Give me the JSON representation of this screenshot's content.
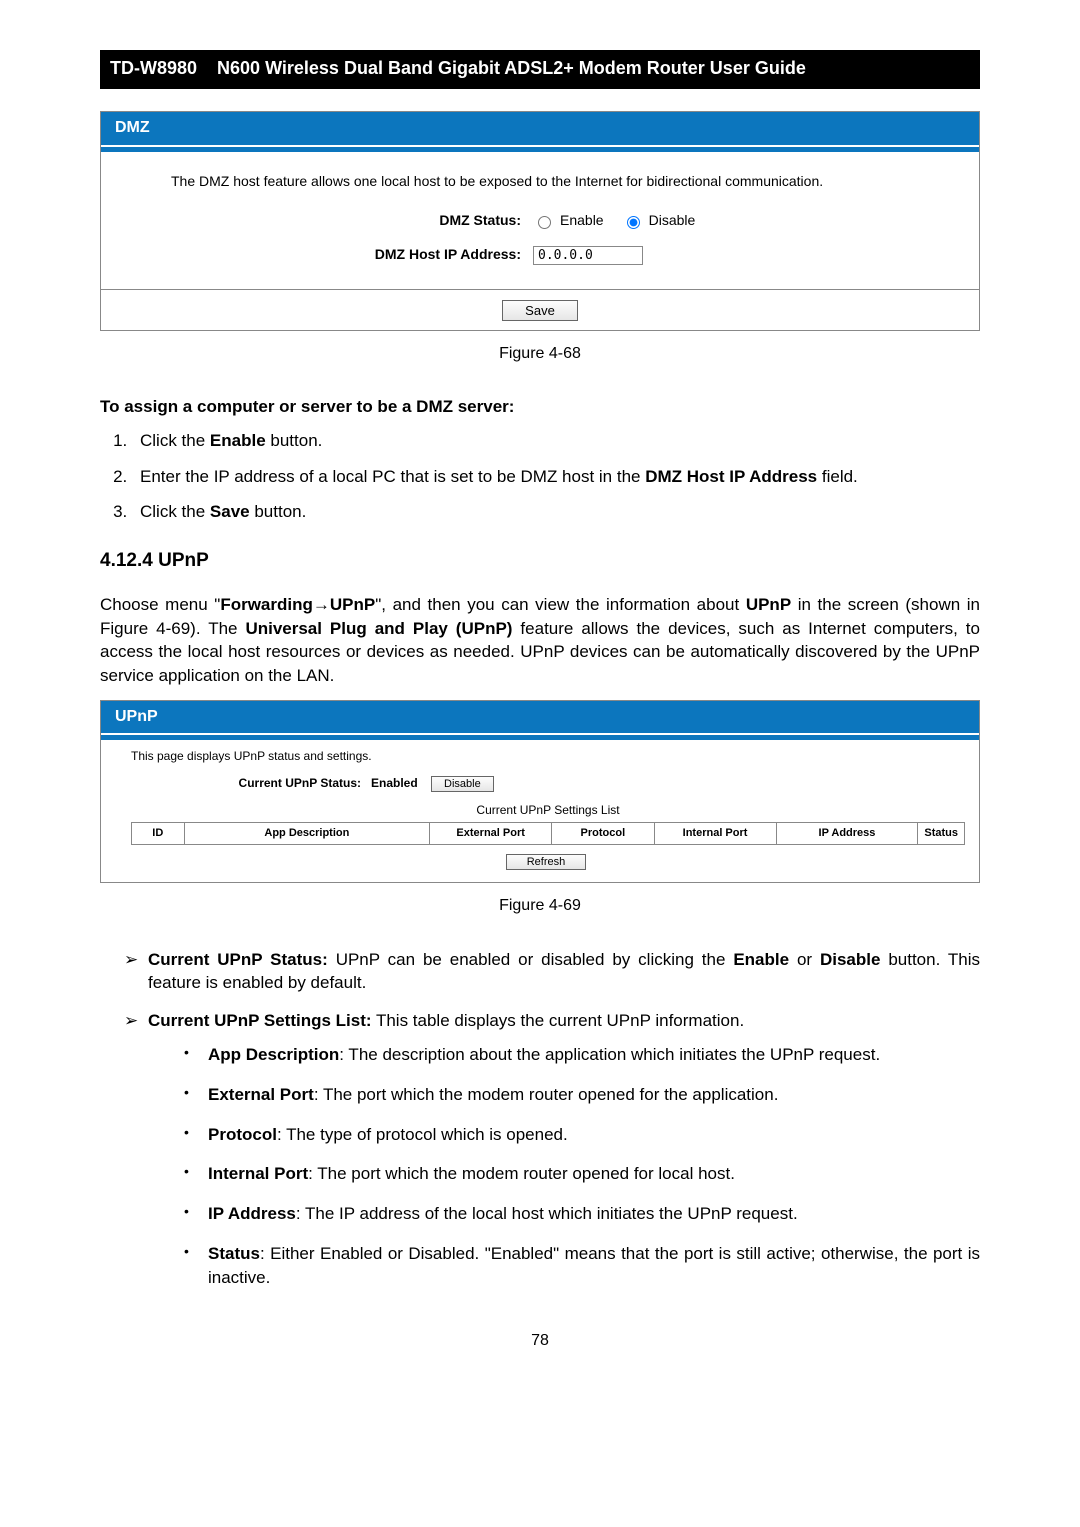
{
  "header": {
    "model": "TD-W8980",
    "title": "N600 Wireless Dual Band Gigabit ADSL2+ Modem Router User Guide"
  },
  "fig68": {
    "panel_title": "DMZ",
    "desc": "The DMZ host feature allows one local host to be exposed to the Internet for bidirectional communication.",
    "status_label": "DMZ Status:",
    "enable": "Enable",
    "disable": "Disable",
    "ip_label": "DMZ Host IP Address:",
    "ip_value": "0.0.0.0",
    "save": "Save",
    "caption": "Figure 4-68"
  },
  "assign": {
    "lead": "To assign a computer or server to be a DMZ server:",
    "step1_a": "Click the ",
    "step1_b": "Enable",
    "step1_c": " button.",
    "step2_a": "Enter the IP address of a local PC that is set to be DMZ host in the ",
    "step2_b": "DMZ Host IP Address",
    "step2_c": " field.",
    "step3_a": "Click the ",
    "step3_b": "Save",
    "step3_c": " button."
  },
  "h3": "4.12.4 UPnP",
  "para1": {
    "a": "Choose menu \"",
    "b": "Forwarding",
    "arrow": "→",
    "c": "UPnP",
    "d": "\", and then you can view the information about ",
    "e": "UPnP",
    "f": " in the screen (shown in Figure 4-69). The ",
    "g": "Universal Plug and Play (UPnP)",
    "h": " feature allows the devices, such as Internet computers, to access the local host resources or devices as needed. UPnP devices can be automatically discovered by the UPnP service application on the LAN."
  },
  "fig69": {
    "panel_title": "UPnP",
    "desc": "This page displays UPnP status and settings.",
    "status_label": "Current UPnP Status:",
    "enabled": "Enabled",
    "disable": "Disable",
    "list_caption": "Current UPnP Settings List",
    "cols": {
      "id": "ID",
      "app": "App Description",
      "ext": "External Port",
      "proto": "Protocol",
      "intp": "Internal Port",
      "ip": "IP Address",
      "status": "Status"
    },
    "refresh": "Refresh",
    "caption": "Figure 4-69"
  },
  "bullets": {
    "b1_a": "Current UPnP Status:",
    "b1_b": " UPnP can be enabled or disabled by clicking the ",
    "b1_c": "Enable",
    "b1_d": " or ",
    "b1_e": "Disable",
    "b1_f": " button. This feature is enabled by default.",
    "b2_a": "Current UPnP Settings List:",
    "b2_b": " This table displays the current UPnP information.",
    "s1_a": "App Description",
    "s1_b": ": The description about the application which initiates the UPnP request.",
    "s2_a": "External Port",
    "s2_b": ": The port which the modem router opened for the application.",
    "s3_a": "Protocol",
    "s3_b": ": The type of protocol which is opened.",
    "s4_a": "Internal Port",
    "s4_b": ": The port which the modem router opened for local host.",
    "s5_a": "IP Address",
    "s5_b": ": The IP address of the local host which initiates the UPnP request.",
    "s6_a": "Status",
    "s6_b": ": Either Enabled or Disabled. \"Enabled\" means that the port is still active; otherwise, the port is inactive."
  },
  "page_number": "78"
}
